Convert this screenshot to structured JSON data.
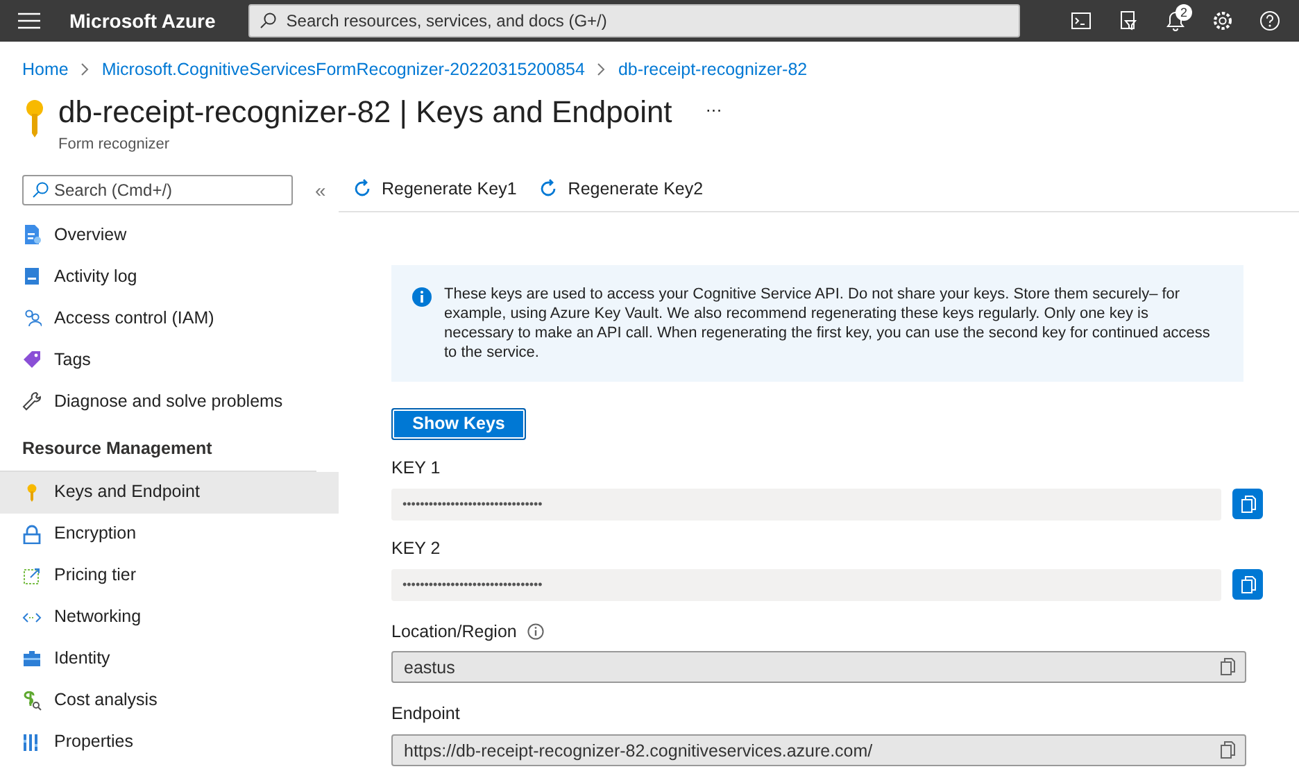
{
  "topbar": {
    "brand": "Microsoft Azure",
    "search": {
      "placeholder": "Search resources, services, and docs (G+/)"
    },
    "notification_count": "2"
  },
  "breadcrumb": [
    "Home",
    "Microsoft.CognitiveServicesFormRecognizer-20220315200854",
    "db-receipt-recognizer-82"
  ],
  "page": {
    "title": "db-receipt-recognizer-82 | Keys and Endpoint",
    "subtitle": "Form recognizer",
    "more": "···"
  },
  "sidebar": {
    "search": {
      "placeholder": "Search (Cmd+/)"
    },
    "collapse": "«",
    "items": [
      {
        "label": "Overview",
        "selected": false
      },
      {
        "label": "Activity log",
        "selected": false
      },
      {
        "label": "Access control (IAM)",
        "selected": false
      },
      {
        "label": "Tags",
        "selected": false
      },
      {
        "label": "Diagnose and solve problems",
        "selected": false
      }
    ],
    "section": "Resource Management",
    "section_items": [
      {
        "label": "Keys and Endpoint",
        "selected": true
      },
      {
        "label": "Encryption",
        "selected": false
      },
      {
        "label": "Pricing tier",
        "selected": false
      },
      {
        "label": "Networking",
        "selected": false
      },
      {
        "label": "Identity",
        "selected": false
      },
      {
        "label": "Cost analysis",
        "selected": false
      },
      {
        "label": "Properties",
        "selected": false
      }
    ]
  },
  "toolbar": [
    "Regenerate Key1",
    "Regenerate Key2"
  ],
  "info": "These keys are used to access your Cognitive Service API. Do not share your keys. Store them securely– for example, using Azure Key Vault. We also recommend regenerating these keys regularly. Only one key is necessary to make an API call. When regenerating the first key, you can use the second key for continued access to the service.",
  "show_keys": "Show Keys",
  "fields": [
    {
      "kind": "secret",
      "label": "KEY 1",
      "value": "••••••••••••••••••••••••••••••••"
    },
    {
      "kind": "secret",
      "label": "KEY 2",
      "value": "••••••••••••••••••••••••••••••••"
    },
    {
      "kind": "readonly",
      "label": "Location/Region",
      "info": true,
      "value": "eastus"
    },
    {
      "kind": "readonly",
      "label": "Endpoint",
      "info": false,
      "value": "https://db-receipt-recognizer-82.cognitiveservices.azure.com/"
    }
  ]
}
